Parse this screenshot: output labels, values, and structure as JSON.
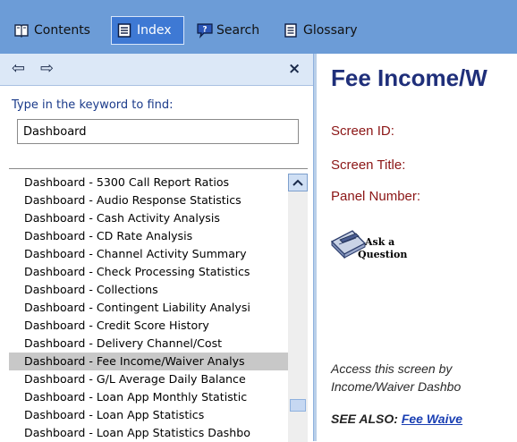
{
  "tabs": {
    "contents": {
      "label": "Contents",
      "icon": "book-icon"
    },
    "index": {
      "label": "Index",
      "icon": "index-icon",
      "active": true
    },
    "search": {
      "label": "Search",
      "icon": "search-icon"
    },
    "glossary": {
      "label": "Glossary",
      "icon": "glossary-icon"
    }
  },
  "nav": {
    "back_icon": "⇦",
    "forward_icon": "⇨",
    "close_icon": "×"
  },
  "index_panel": {
    "find_label": "Type in the keyword to find:",
    "keyword_value": "Dashboard",
    "items": [
      "Dashboard - 5300 Call Report Ratios",
      "Dashboard - Audio Response Statistics",
      "Dashboard - Cash Activity Analysis",
      "Dashboard - CD Rate Analysis",
      "Dashboard - Channel Activity Summary",
      "Dashboard - Check Processing Statistics",
      "Dashboard - Collections",
      "Dashboard - Contingent Liability Analysi",
      "Dashboard - Credit Score History",
      "Dashboard - Delivery Channel/Cost",
      "Dashboard - Fee Income/Waiver Analys",
      "Dashboard - G/L Average Daily Balance",
      "Dashboard - Loan App Monthly Statistic",
      "Dashboard - Loan App Statistics",
      "Dashboard - Loan App Statistics Dashbo"
    ],
    "selected_index": 10
  },
  "content": {
    "title": "Fee Income/W",
    "screen_id_label": "Screen ID:",
    "screen_title_label": "Screen Title:",
    "panel_number_label": "Panel Number:",
    "ask_question_line1": "Ask a",
    "ask_question_line2": "Question",
    "access_line1": "Access this screen by",
    "access_line2": "Income/Waiver Dashbo",
    "see_also_label": "SEE ALSO:",
    "see_also_link": "Fee Waive"
  },
  "colors": {
    "tabbar": "#6c9cd7",
    "active_tab": "#3e79d4",
    "title": "#1f2f7a",
    "field_label": "#8b1515",
    "link": "#1a3fb3"
  }
}
